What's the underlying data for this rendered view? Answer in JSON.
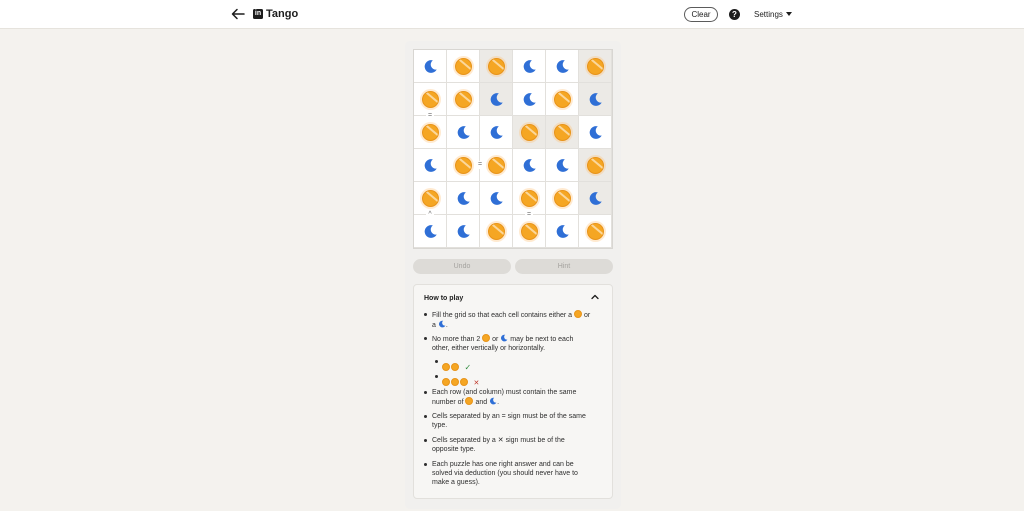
{
  "header": {
    "app_title": "Tango",
    "logo_text": "in",
    "clear_label": "Clear",
    "help_label": "?",
    "settings_label": "Settings"
  },
  "colors": {
    "sun": "#f5a623",
    "moon": "#2f6fd6",
    "locked_cell": "#eceae6"
  },
  "grid": {
    "rows": [
      [
        "moon",
        "sun",
        "sun",
        "moon",
        "moon",
        "sun"
      ],
      [
        "sun",
        "sun",
        "moon",
        "moon",
        "sun",
        "moon"
      ],
      [
        "sun",
        "moon",
        "moon",
        "sun",
        "sun",
        "moon"
      ],
      [
        "moon",
        "sun",
        "sun",
        "moon",
        "moon",
        "sun"
      ],
      [
        "sun",
        "moon",
        "moon",
        "sun",
        "sun",
        "moon"
      ],
      [
        "moon",
        "moon",
        "sun",
        "sun",
        "moon",
        "sun"
      ]
    ],
    "locked": [
      [
        0,
        0,
        1,
        0,
        0,
        1
      ],
      [
        0,
        0,
        1,
        0,
        0,
        1
      ],
      [
        0,
        0,
        0,
        1,
        1,
        0
      ],
      [
        0,
        0,
        0,
        0,
        0,
        1
      ],
      [
        0,
        0,
        0,
        0,
        0,
        1
      ],
      [
        0,
        0,
        0,
        0,
        0,
        0
      ]
    ],
    "constraints": [
      {
        "between": [
          [
            1,
            0
          ],
          [
            2,
            0
          ]
        ],
        "sign": "="
      },
      {
        "between": [
          [
            3,
            1
          ],
          [
            3,
            2
          ]
        ],
        "sign": "="
      },
      {
        "between": [
          [
            4,
            0
          ],
          [
            5,
            0
          ]
        ],
        "sign": "^"
      },
      {
        "between": [
          [
            4,
            3
          ],
          [
            5,
            3
          ]
        ],
        "sign": "="
      }
    ]
  },
  "actions": {
    "undo_label": "Undo",
    "hint_label": "Hint"
  },
  "how_to_play": {
    "title": "How to play",
    "rule1_pre": "Fill the grid so that each cell contains either a",
    "rule1_or": "or",
    "rule1_a": "a",
    "rule1_end": ".",
    "rule2_pre": "No more than 2",
    "rule2_or": "or",
    "rule2_post": "may be next to each other, either vertically or horizontally.",
    "rule3_pre": "Each row (and column) must contain the same number of",
    "rule3_and": "and",
    "rule3_end": ".",
    "rule4": "Cells separated by an = sign must be of the same type.",
    "rule5_pre": "Cells separated by a",
    "rule5_post": "sign must be of the opposite type.",
    "rule6": "Each puzzle has one right answer and can be solved via deduction (you should never have to make a guess)."
  }
}
